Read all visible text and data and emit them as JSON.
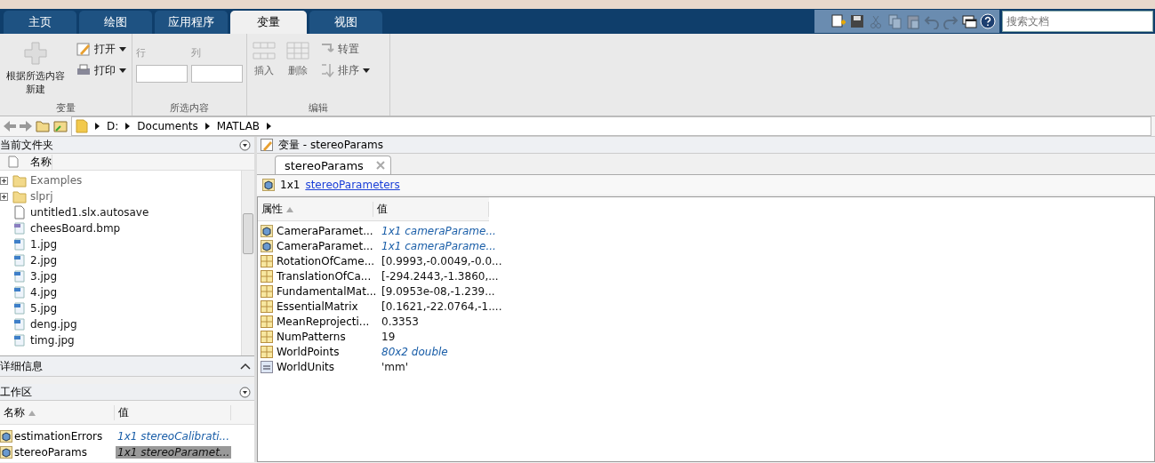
{
  "tabs": [
    {
      "label": "主页",
      "selected": false
    },
    {
      "label": "绘图",
      "selected": false
    },
    {
      "label": "应用程序",
      "selected": false
    },
    {
      "label": "变量",
      "selected": true
    },
    {
      "label": "视图",
      "selected": false
    }
  ],
  "quick_access": [
    {
      "kind": "new",
      "disabled": false
    },
    {
      "kind": "save",
      "disabled": false
    },
    {
      "kind": "cut",
      "disabled": true
    },
    {
      "kind": "copy",
      "disabled": true
    },
    {
      "kind": "paste",
      "disabled": true
    },
    {
      "kind": "undo",
      "disabled": true
    },
    {
      "kind": "redo",
      "disabled": true
    },
    {
      "kind": "window",
      "disabled": false
    },
    {
      "kind": "help",
      "disabled": false
    }
  ],
  "search": {
    "placeholder": "搜索文档"
  },
  "ribbon": {
    "variable": {
      "new_label": "根据所选内容新建",
      "open": "打开",
      "print": "打印",
      "group": "变量"
    },
    "selection": {
      "row_label": "行",
      "col_label": "列",
      "group": "所选内容"
    },
    "edit": {
      "items": [
        {
          "label": "插入",
          "kind": "insert",
          "disabled": true
        },
        {
          "label": "删除",
          "kind": "delete",
          "disabled": true
        }
      ],
      "transpose": "转置",
      "sort": "排序",
      "group": "编辑"
    }
  },
  "address": {
    "path": [
      "D:",
      "Documents",
      "MATLAB"
    ]
  },
  "current_folder": {
    "title": "当前文件夹",
    "column": "名称",
    "items": [
      {
        "name": "Examples",
        "kind": "folder",
        "expandable": true
      },
      {
        "name": "slprj",
        "kind": "folder",
        "expandable": true
      },
      {
        "name": "untitled1.slx.autosave",
        "kind": "file",
        "expandable": false
      },
      {
        "name": "cheesBoard.bmp",
        "kind": "bmp",
        "expandable": false
      },
      {
        "name": "1.jpg",
        "kind": "jpg",
        "expandable": false
      },
      {
        "name": "2.jpg",
        "kind": "jpg",
        "expandable": false
      },
      {
        "name": "3.jpg",
        "kind": "jpg",
        "expandable": false
      },
      {
        "name": "4.jpg",
        "kind": "jpg",
        "expandable": false
      },
      {
        "name": "5.jpg",
        "kind": "jpg",
        "expandable": false
      },
      {
        "name": "deng.jpg",
        "kind": "jpg",
        "expandable": false
      },
      {
        "name": "timg.jpg",
        "kind": "jpg",
        "expandable": false
      }
    ]
  },
  "details": {
    "title": "详细信息"
  },
  "workspace": {
    "title": "工作区",
    "columns": [
      "名称",
      "值"
    ],
    "rows": [
      {
        "name": "estimationErrors",
        "value": "1x1 stereoCalibrati...",
        "selected": false
      },
      {
        "name": "stereoParams",
        "value": "1x1 stereoParamet...",
        "selected": true
      }
    ]
  },
  "variable_editor": {
    "title": "变量 - stereoParams",
    "tab": "stereoParams",
    "size": "1x1",
    "class_link": "stereoParameters",
    "columns": [
      "属性",
      "值"
    ],
    "rows": [
      {
        "name": "CameraParamet...",
        "value": "1x1 cameraParame...",
        "kind": "object",
        "italic": true
      },
      {
        "name": "CameraParamet...",
        "value": "1x1 cameraParame...",
        "kind": "object",
        "italic": true
      },
      {
        "name": "RotationOfCame...",
        "value": "[0.9993,-0.0049,-0.0...",
        "kind": "matrix",
        "italic": false
      },
      {
        "name": "TranslationOfCa...",
        "value": "[-294.2443,-1.3860,...",
        "kind": "matrix",
        "italic": false
      },
      {
        "name": "FundamentalMat...",
        "value": "[9.0953e-08,-1.239...",
        "kind": "matrix",
        "italic": false
      },
      {
        "name": "EssentialMatrix",
        "value": "[0.1621,-22.0764,-1....",
        "kind": "matrix",
        "italic": false
      },
      {
        "name": "MeanReprojecti...",
        "value": "0.3353",
        "kind": "matrix",
        "italic": false
      },
      {
        "name": "NumPatterns",
        "value": "19",
        "kind": "matrix",
        "italic": false
      },
      {
        "name": "WorldPoints",
        "value": "80x2 double",
        "kind": "matrix",
        "italic": true
      },
      {
        "name": "WorldUnits",
        "value": "'mm'",
        "kind": "text",
        "italic": false
      }
    ]
  }
}
